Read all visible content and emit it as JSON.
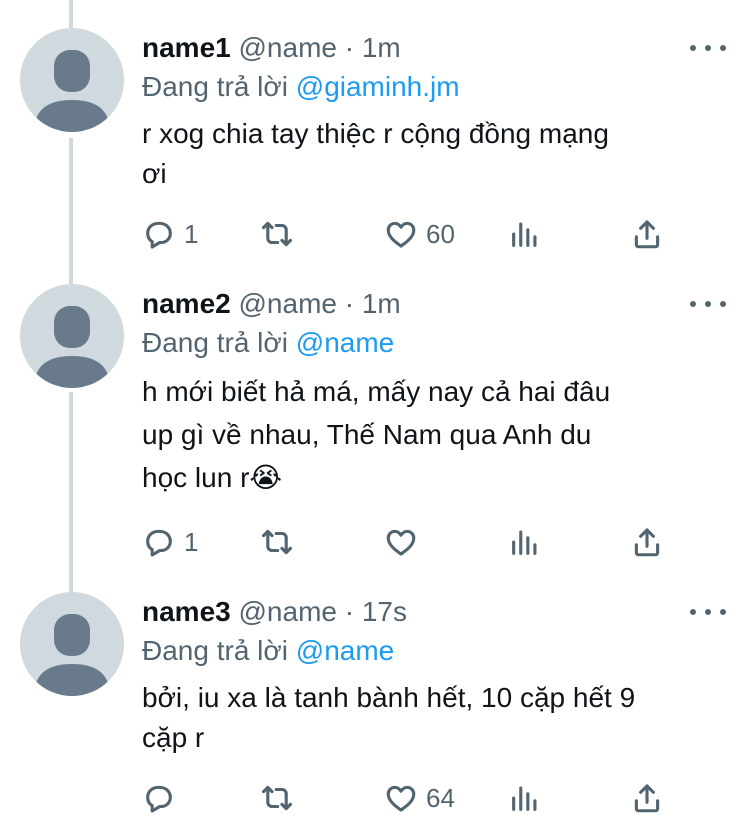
{
  "tweets": [
    {
      "name": "name1",
      "handle": "@name",
      "sep": " · ",
      "time": "1m",
      "reply_prefix": "Đang trả lời ",
      "reply_to": "@giaminh.jm",
      "lines": [
        "r xog chia tay thiệc r cộng đồng mạng",
        "ơi"
      ],
      "reply_count": "1",
      "retweet_count": "",
      "like_count": "60"
    },
    {
      "name": "name2",
      "handle": "@name",
      "sep": " · ",
      "time": "1m",
      "reply_prefix": "Đang trả lời ",
      "reply_to": "@name",
      "lines": [
        "h mới biết hả má, mấy nay cả hai đâu",
        "up gì về nhau, Thế Nam qua Anh du",
        "học lun r😭"
      ],
      "reply_count": "1",
      "retweet_count": "",
      "like_count": ""
    },
    {
      "name": "name3",
      "handle": "@name",
      "sep": " · ",
      "time": "17s",
      "reply_prefix": "Đang trả lời ",
      "reply_to": "@name",
      "lines": [
        "bởi, iu xa là tanh bành hết, 10 cặp hết 9",
        "cặp r"
      ],
      "reply_count": "",
      "retweet_count": "",
      "like_count": "64"
    }
  ],
  "icons": {
    "more": "more-horizontal-icon",
    "reply": "reply-icon",
    "retweet": "retweet-icon",
    "like": "heart-icon",
    "views": "analytics-icon",
    "share": "share-icon"
  },
  "colors": {
    "link": "#1d9bf0",
    "secondary_text": "#536471",
    "primary_text": "#0f1419",
    "avatar_bg": "#cfd9de",
    "avatar_fg": "#687a8b",
    "thread_line": "#cfd9de"
  }
}
